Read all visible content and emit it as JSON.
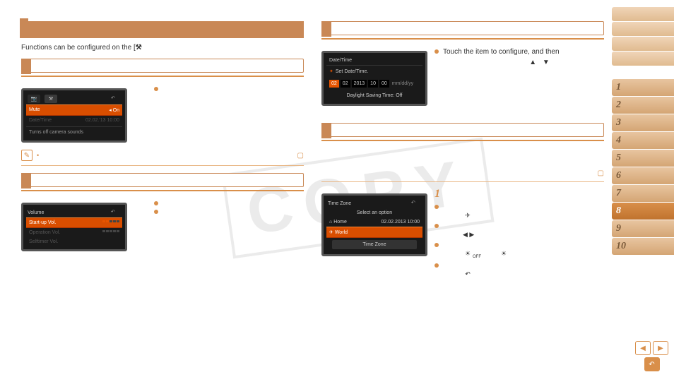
{
  "watermark": "COPY",
  "intro": {
    "text": "Functions can be configured on the [",
    "toolsIcon": "⚒"
  },
  "configText": "Touch the item to configure, and then",
  "arrows": "▲  ▼",
  "lcd1": {
    "muteLabel": "Mute",
    "muteValue": "◂ On",
    "dimLabel": "Date/Time",
    "dimValue": "02.02.'13 10:00",
    "footer": "Turns off camera sounds"
  },
  "lcd2": {
    "title": "Volume",
    "rowLabel": "Start-up Vol.",
    "opLabel": "Operation Vol.",
    "selfLabel": "Selftimer Vol."
  },
  "lcd3": {
    "title": "Date/Time",
    "star": "✦",
    "setLabel": "Set Date/Time.",
    "d1": "02",
    "d2": "02",
    "d3": "2013",
    "d4": "10",
    "d5": "00",
    "fmt": "mm/dd/yy",
    "dst": "Daylight Saving Time: Off"
  },
  "lcd4": {
    "title": "Time Zone",
    "select": "Select an option",
    "homeIcon": "⌂",
    "homeLabel": "Home",
    "homeVal": "02.02.2013 10:00",
    "worldIcon": "✈",
    "worldLabel": "World",
    "btn": "Time Zone"
  },
  "step1": "1",
  "icons": {
    "plane": "✈",
    "lr": "◀  ▶",
    "sunOff": "☀",
    "sunOn": "☀",
    "return": "↶"
  },
  "nav": {
    "n1": "1",
    "n2": "2",
    "n3": "3",
    "n4": "4",
    "n5": "5",
    "n6": "6",
    "n7": "7",
    "n8": "8",
    "n9": "9",
    "n10": "10"
  },
  "bottomNav": {
    "prev": "◀",
    "next": "▶",
    "ret": "↶"
  },
  "bookIcon": "▢",
  "pencilIcon": "✎",
  "dot": "•"
}
